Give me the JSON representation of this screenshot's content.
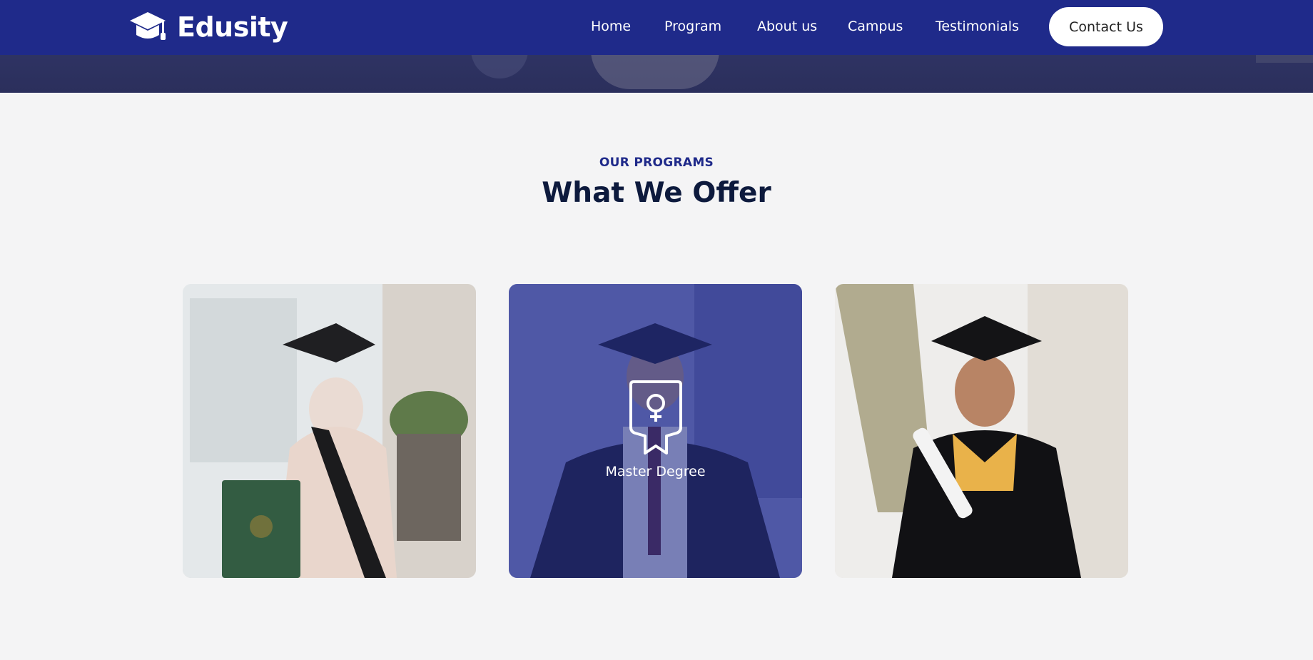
{
  "navbar": {
    "brand": "Edusity",
    "links": [
      "Home",
      "Program",
      "About us",
      "Campus",
      "Testimonials"
    ],
    "cta": "Contact Us"
  },
  "programs": {
    "eyebrow": "OUR PROGRAMS",
    "heading": "What We Offer",
    "cards": [
      {
        "label": ""
      },
      {
        "label": "Master Degree"
      },
      {
        "label": ""
      }
    ]
  },
  "colors": {
    "nav_bg": "#1f2a8a",
    "heading": "#0d1a3d",
    "accent": "#1f2a8a",
    "page_bg": "#f4f4f5"
  }
}
